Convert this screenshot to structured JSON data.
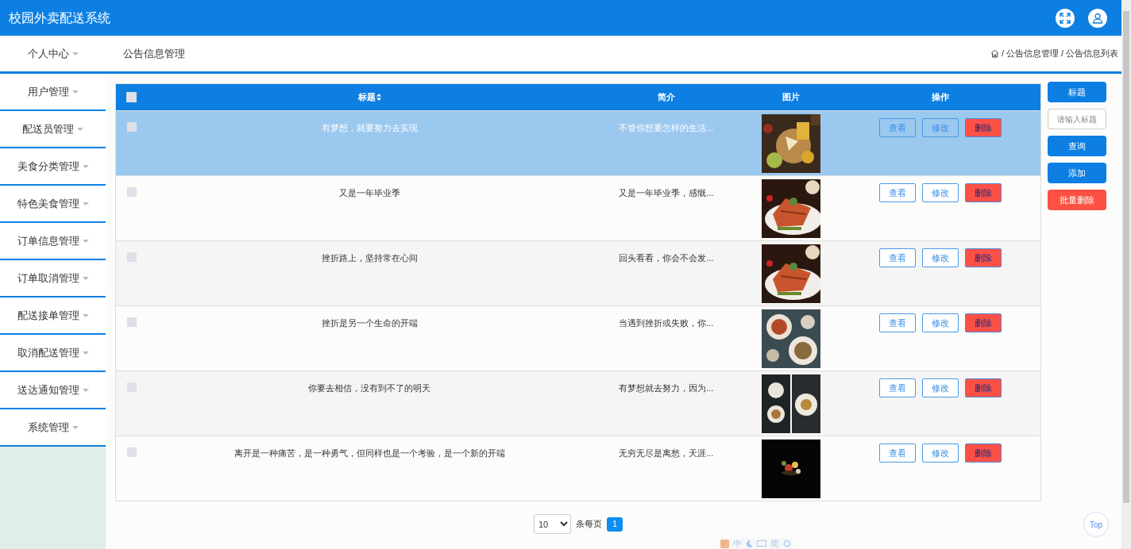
{
  "header": {
    "title": "校园外卖配送系统"
  },
  "sidebar": {
    "items": [
      {
        "label": "个人中心"
      },
      {
        "label": "用户管理"
      },
      {
        "label": "配送员管理"
      },
      {
        "label": "美食分类管理"
      },
      {
        "label": "特色美食管理"
      },
      {
        "label": "订单信息管理"
      },
      {
        "label": "订单取消管理"
      },
      {
        "label": "配送接单管理"
      },
      {
        "label": "取消配送管理"
      },
      {
        "label": "送达通知管理"
      },
      {
        "label": "系统管理"
      }
    ]
  },
  "page_title": "公告信息管理",
  "breadcrumb": [
    {
      "separator": "/",
      "label": "公告信息管理"
    },
    {
      "separator": "/",
      "label": "公告信息列表"
    }
  ],
  "table": {
    "columns": [
      "标题",
      "简介",
      "图片",
      "操作"
    ],
    "all_checked": false,
    "rows": [
      {
        "title": "有梦想，就要努力去实现",
        "intro": "不管你想要怎样的生活...",
        "selected": true,
        "checked": false,
        "kind": "picture",
        "actions": [
          "查看",
          "修改",
          "删除"
        ]
      },
      {
        "title": "又是一年毕业季",
        "intro": "又是一年毕业季，感慨...",
        "selected": false,
        "checked": false,
        "kind": "picture",
        "actions": [
          "查看",
          "修改",
          "删除"
        ]
      },
      {
        "title": "挫折路上，坚持常在心间",
        "intro": "回头看看，你会不会发...",
        "selected": false,
        "checked": false,
        "kind": "picture",
        "actions": [
          "查看",
          "修改",
          "删除"
        ]
      },
      {
        "title": "挫折是另一个生命的开端",
        "intro": "当遇到挫折或失败，你...",
        "selected": false,
        "checked": false,
        "kind": "picture",
        "actions": [
          "查看",
          "修改",
          "删除"
        ]
      },
      {
        "title": "你要去相信，没有到不了的明天",
        "intro": "有梦想就去努力，因为...",
        "selected": false,
        "checked": false,
        "kind": "picture",
        "actions": [
          "查看",
          "修改",
          "删除"
        ]
      },
      {
        "title": "离开是一种痛苦，是一种勇气，但同样也是一个考验，是一个新的开端",
        "intro": "无穷无尽是离愁，天涯...",
        "selected": false,
        "checked": false,
        "kind": "picture",
        "actions": [
          "查看",
          "修改",
          "删除"
        ]
      }
    ]
  },
  "search": {
    "label": "标题",
    "placeholder": "请输入标题",
    "buttons": [
      "查询",
      "添加",
      "批量删除"
    ]
  },
  "pagination": {
    "page_size": "10",
    "per_page_label": "条每页",
    "pages": [
      {
        "label": "1",
        "selected": true
      }
    ]
  },
  "ime_bar": {
    "items": [
      "中",
      "简"
    ]
  },
  "top_button": "Top"
}
